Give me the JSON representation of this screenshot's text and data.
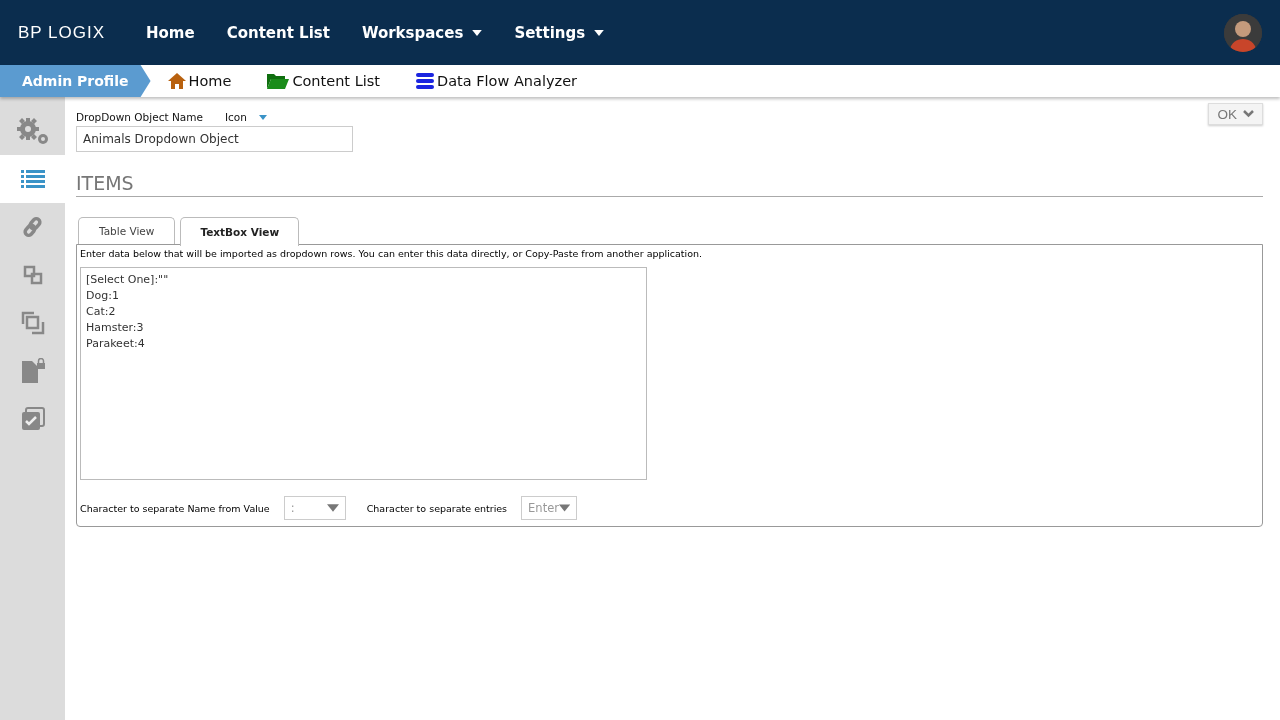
{
  "header": {
    "logo": "BP LOGIX",
    "nav": [
      {
        "label": "Home",
        "dropdown": false
      },
      {
        "label": "Content List",
        "dropdown": false
      },
      {
        "label": "Workspaces",
        "dropdown": true
      },
      {
        "label": "Settings",
        "dropdown": true
      }
    ]
  },
  "breadcrumb": {
    "profile": "Admin Profile",
    "links": [
      {
        "label": "Home",
        "kind": "home"
      },
      {
        "label": "Content List",
        "kind": "folder"
      },
      {
        "label": "Data Flow Analyzer",
        "kind": "stack"
      }
    ]
  },
  "sidebar": {
    "items": [
      {
        "kind": "gears",
        "selected": false
      },
      {
        "kind": "list",
        "selected": true
      },
      {
        "kind": "link",
        "selected": false
      },
      {
        "kind": "squares",
        "selected": false
      },
      {
        "kind": "copy",
        "selected": false
      },
      {
        "kind": "doclock",
        "selected": false
      },
      {
        "kind": "check",
        "selected": false
      }
    ]
  },
  "form": {
    "name_label": "DropDown Object Name",
    "icon_label": "Icon",
    "name_value": "Animals Dropdown Object",
    "ok_button": "OK"
  },
  "items": {
    "title": "ITEMS",
    "tabs": [
      {
        "label": "Table View",
        "selected": false
      },
      {
        "label": "TextBox View",
        "selected": true
      }
    ],
    "instructions": "Enter data below that will be imported as dropdown rows. You can enter this data directly, or Copy-Paste from another application.",
    "lines": [
      "[Select One]:\"\"",
      "Dog:1",
      "Cat:2",
      "Hamster:3",
      "Parakeet:4"
    ],
    "name_sep_label": "Character to separate Name from Value",
    "name_sep_value": ":",
    "entry_sep_label": "Character to separate entries",
    "entry_sep_value": "Enter"
  }
}
